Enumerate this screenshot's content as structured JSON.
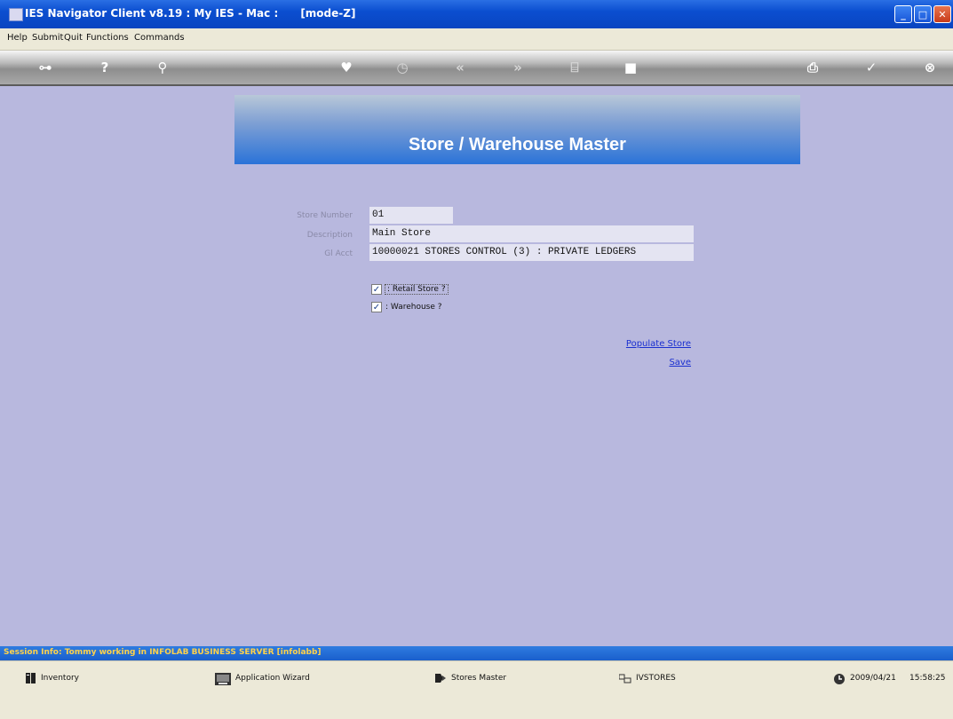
{
  "window": {
    "title": "IES Navigator Client v8.19 : My IES - Mac :      [mode-Z]"
  },
  "menu": {
    "items": [
      "Help",
      "Submit",
      "Quit",
      "Functions",
      "Commands"
    ]
  },
  "toolbar": {
    "icons": [
      "key-icon",
      "help-icon",
      "search-icon",
      "heart-icon",
      "clock-icon",
      "rewind-icon",
      "forward-icon",
      "bookmark-icon",
      "stop-icon",
      "print-icon",
      "check-icon",
      "close-icon"
    ]
  },
  "banner": {
    "title": "Store / Warehouse Master"
  },
  "form": {
    "store_number_label": "Store Number",
    "store_number_value": "01",
    "description_label": "Description",
    "description_value": "Main Store",
    "gl_acct_label": "Gl Acct",
    "gl_acct_value": "10000021 STORES CONTROL (3) : PRIVATE LEDGERS",
    "retail_store_label": ": Retail Store ?",
    "retail_store_checked": true,
    "warehouse_label": ": Warehouse ?",
    "warehouse_checked": true
  },
  "actions": {
    "populate_store": "Populate Store",
    "save": "Save"
  },
  "session": {
    "info": "Session Info: Tommy working in INFOLAB BUSINESS SERVER  [infolabb]"
  },
  "statusbar": {
    "inventory": "Inventory",
    "app_wizard": "Application Wizard",
    "stores_master": "Stores Master",
    "ivstores": "IVSTORES",
    "date": "2009/04/21",
    "time": "15:58:25"
  }
}
